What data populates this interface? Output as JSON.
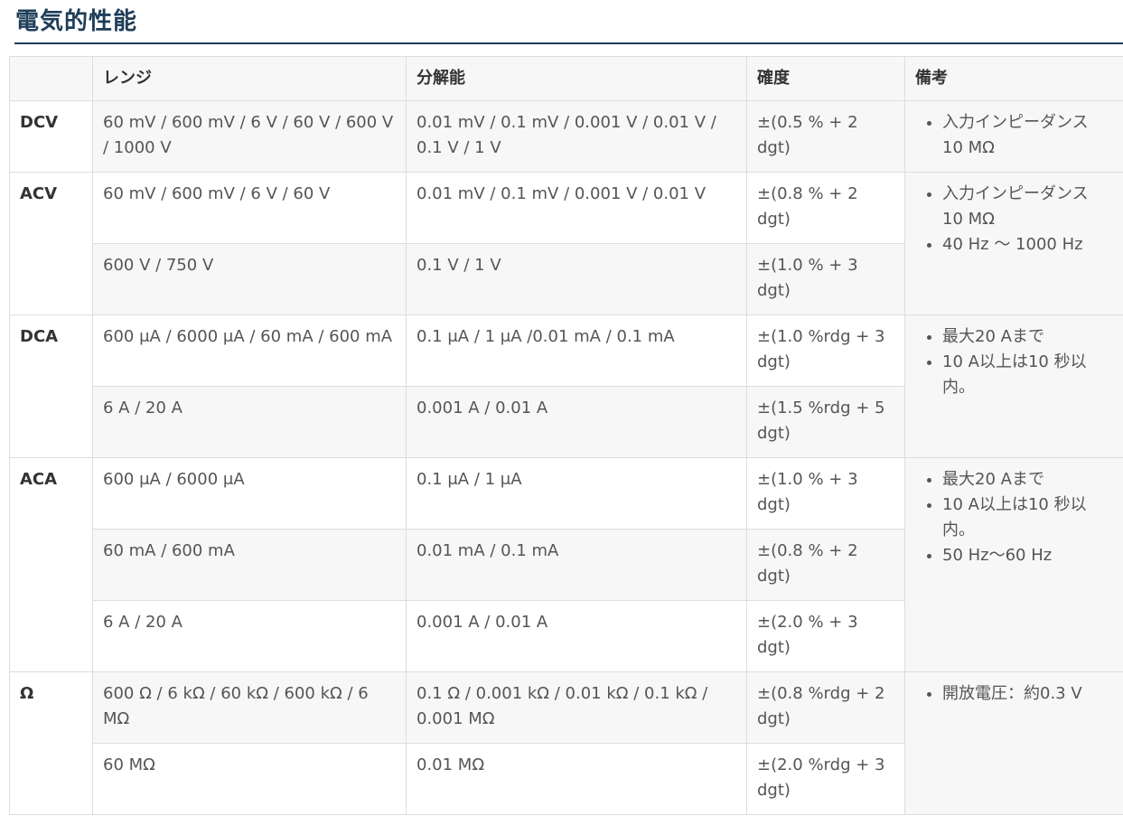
{
  "title": "電気的性能",
  "table": {
    "headers": [
      "",
      "レンジ",
      "分解能",
      "確度",
      "備考"
    ],
    "groups": [
      {
        "label": "DCV",
        "notes": [
          "入力インピーダンス 10 MΩ"
        ],
        "rows": [
          {
            "range": "60 mV / 600 mV / 6 V / 60 V / 600 V / 1000 V",
            "resolution": "0.01 mV / 0.1 mV / 0.001 V / 0.01 V / 0.1 V / 1 V",
            "accuracy": "±(0.5 % + 2 dgt)"
          }
        ]
      },
      {
        "label": "ACV",
        "notes": [
          "入力インピーダンス 10 MΩ",
          "40 Hz ～ 1000 Hz"
        ],
        "rows": [
          {
            "range": "60 mV / 600 mV / 6 V / 60 V",
            "resolution": "0.01 mV / 0.1 mV / 0.001 V / 0.01 V",
            "accuracy": "±(0.8 % + 2 dgt)"
          },
          {
            "range": "600 V / 750 V",
            "resolution": "0.1 V / 1 V",
            "accuracy": "±(1.0 % + 3 dgt)"
          }
        ]
      },
      {
        "label": "DCA",
        "notes": [
          "最大20 Aまで",
          "10 A以上は10 秒以内。"
        ],
        "rows": [
          {
            "range": "600 μA / 6000 μA / 60 mA / 600 mA",
            "resolution": "0.1 μA / 1 μA /0.01 mA / 0.1 mA",
            "accuracy": "±(1.0 %rdg + 3 dgt)"
          },
          {
            "range": "6 A / 20 A",
            "resolution": "0.001 A / 0.01 A",
            "accuracy": "±(1.5 %rdg + 5 dgt)"
          }
        ]
      },
      {
        "label": "ACA",
        "notes": [
          "最大20 Aまで",
          "10 A以上は10 秒以内。",
          "50 Hz～60 Hz"
        ],
        "rows": [
          {
            "range": "600 μA / 6000 μA",
            "resolution": "0.1 μA / 1 μA",
            "accuracy": "±(1.0 % + 3 dgt)"
          },
          {
            "range": "60 mA / 600 mA",
            "resolution": "0.01 mA / 0.1 mA",
            "accuracy": "±(0.8 % + 2 dgt)"
          },
          {
            "range": "6 A / 20 A",
            "resolution": "0.001 A / 0.01 A",
            "accuracy": "±(2.0 % + 3 dgt)"
          }
        ]
      },
      {
        "label": "Ω",
        "notes": [
          "開放電圧：約0.3 V"
        ],
        "rows": [
          {
            "range": "600 Ω / 6 kΩ / 60 kΩ / 600 kΩ / 6 MΩ",
            "resolution": "0.1 Ω / 0.001 kΩ / 0.01 kΩ / 0.1 kΩ / 0.001 MΩ",
            "accuracy": "±(0.8 %rdg + 2 dgt)"
          },
          {
            "range": "60 MΩ",
            "resolution": "0.01 MΩ",
            "accuracy": "±(2.0 %rdg + 3 dgt)"
          }
        ]
      }
    ]
  }
}
